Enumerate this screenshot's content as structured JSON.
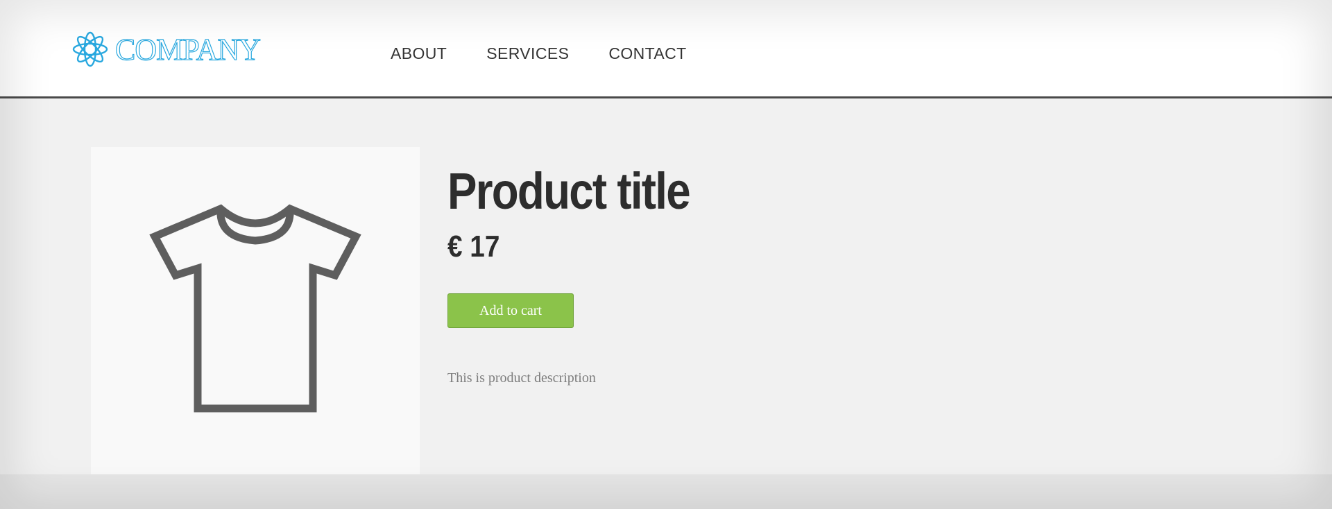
{
  "header": {
    "logo_text": "COMPANY",
    "nav": [
      {
        "label": "ABOUT"
      },
      {
        "label": "SERVICES"
      },
      {
        "label": "CONTACT"
      }
    ]
  },
  "product": {
    "title": "Product title",
    "price": "€ 17",
    "add_to_cart_label": "Add to cart",
    "description": "This is product description",
    "image_icon": "t-shirt-icon"
  },
  "colors": {
    "brand": "#29a8df",
    "button": "#8bc34a",
    "text_dark": "#2d2d2d",
    "text_muted": "#7d7d7d",
    "header_rule": "#4a4a4a"
  }
}
